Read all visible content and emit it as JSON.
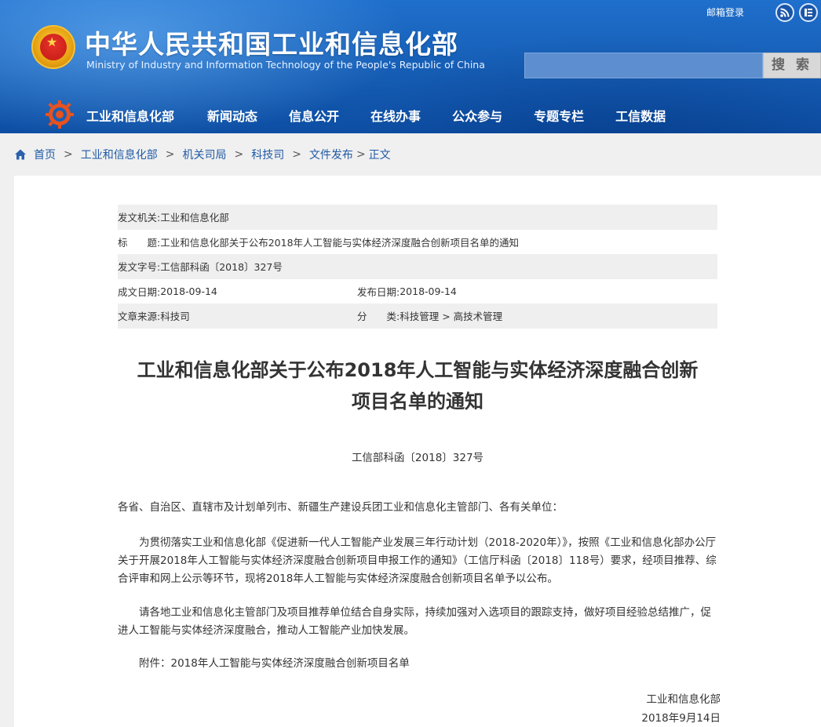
{
  "header": {
    "site_title": "中华人民共和国工业和信息化部",
    "site_subtitle": "Ministry of Industry and Information Technology of the People's Republic of China",
    "mail_login": "邮箱登录",
    "search_placeholder": "",
    "search_button": "搜 索",
    "icons": [
      "rss-icon",
      "weibo-icon"
    ]
  },
  "nav": {
    "items": [
      "工业和信息化部",
      "新闻动态",
      "信息公开",
      "在线办事",
      "公众参与",
      "专题专栏",
      "工信数据"
    ]
  },
  "breadcrumb": {
    "items": [
      "首页",
      "工业和信息化部",
      "机关司局",
      "科技司",
      "文件发布",
      "正文"
    ],
    "separator": ">"
  },
  "meta": {
    "issuer_label": "发文机关:",
    "issuer": "工业和信息化部",
    "title_label": "标　　题:",
    "title": "工业和信息化部关于公布2018年人工智能与实体经济深度融合创新项目名单的通知",
    "doc_no_label": "发文字号:",
    "doc_no": "工信部科函〔2018〕327号",
    "written_date_label": "成文日期:",
    "written_date": "2018-09-14",
    "publish_date_label": "发布日期:",
    "publish_date": "2018-09-14",
    "source_label": "文章来源:",
    "source": "科技司",
    "category_label": "分　　类:",
    "category": "科技管理 > 高技术管理"
  },
  "article": {
    "title_line1": "工业和信息化部关于公布2018年人工智能与实体经济深度融合创新",
    "title_line2": "项目名单的通知",
    "doc_number": "工信部科函〔2018〕327号",
    "salutation": "各省、自治区、直辖市及计划单列市、新疆生产建设兵团工业和信息化主管部门、各有关单位：",
    "para1": "为贯彻落实工业和信息化部《促进新一代人工智能产业发展三年行动计划（2018-2020年）》，按照《工业和信息化部办公厅关于开展2018年人工智能与实体经济深度融合创新项目申报工作的通知》（工信厅科函〔2018〕118号）要求，经项目推荐、综合评审和网上公示等环节，现将2018年人工智能与实体经济深度融合创新项目名单予以公布。",
    "para2": "请各地工业和信息化主管部门及项目推荐单位结合自身实际，持续加强对入选项目的跟踪支持，做好项目经验总结推广，促进人工智能与实体经济深度融合，推动人工智能产业加快发展。",
    "attachment": "附件：2018年人工智能与实体经济深度融合创新项目名单",
    "sign_org": "工业和信息化部",
    "sign_date": "2018年9月14日"
  },
  "colors": {
    "header_blue": "#1760b8",
    "link_blue": "#1f5aa6",
    "row_shade": "#efefef"
  }
}
